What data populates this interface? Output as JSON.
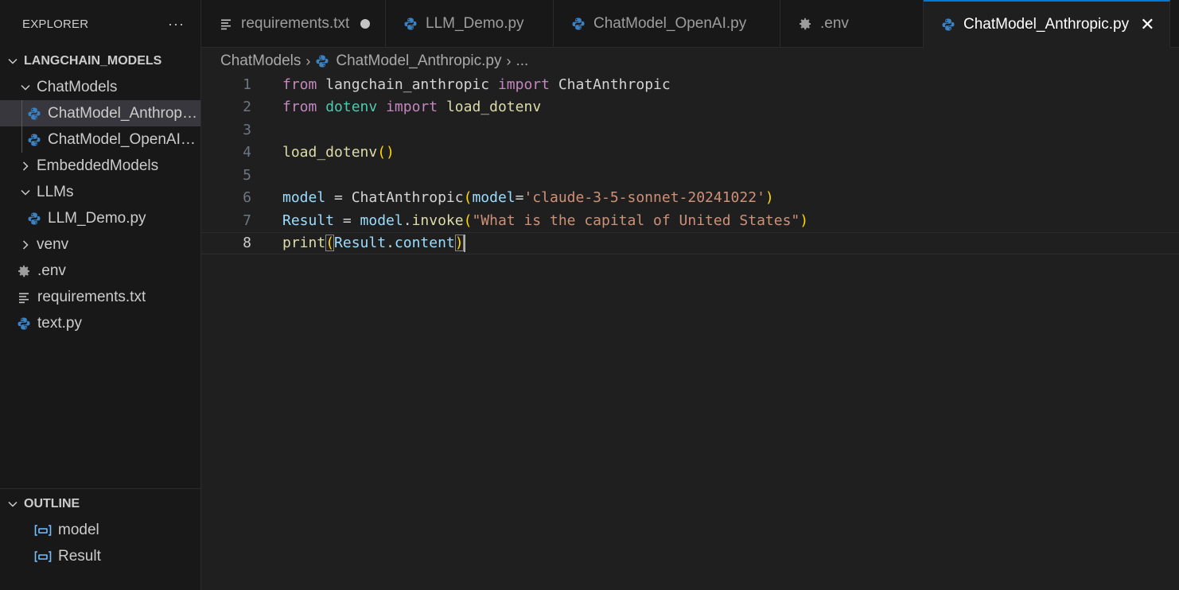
{
  "explorer": {
    "title": "EXPLORER",
    "more": "···",
    "root": "LANGCHAIN_MODELS",
    "items": [
      {
        "label": "ChatModels"
      },
      {
        "label": "ChatModel_Anthropic.py"
      },
      {
        "label": "ChatModel_OpenAI.py"
      },
      {
        "label": "EmbeddedModels"
      },
      {
        "label": "LLMs"
      },
      {
        "label": "LLM_Demo.py"
      },
      {
        "label": "venv"
      },
      {
        "label": ".env"
      },
      {
        "label": "requirements.txt"
      },
      {
        "label": "text.py"
      }
    ]
  },
  "outline": {
    "title": "OUTLINE",
    "items": [
      {
        "label": "model"
      },
      {
        "label": "Result"
      }
    ]
  },
  "tabs": [
    {
      "label": "requirements.txt"
    },
    {
      "label": "LLM_Demo.py"
    },
    {
      "label": "ChatModel_OpenAI.py"
    },
    {
      "label": ".env"
    },
    {
      "label": "ChatModel_Anthropic.py",
      "close": "✕"
    }
  ],
  "breadcrumb": {
    "folder": "ChatModels",
    "file": "ChatModel_Anthropic.py",
    "more": "..."
  },
  "editor": {
    "line_numbers": [
      "1",
      "2",
      "3",
      "4",
      "5",
      "6",
      "7",
      "8"
    ],
    "tokens": {
      "from": "from",
      "import": "import",
      "langchain_anthropic": "langchain_anthropic",
      "ChatAnthropic": "ChatAnthropic",
      "dotenv": "dotenv",
      "load_dotenv": "load_dotenv",
      "parens": "()",
      "model": "model",
      "eq": " = ",
      "open": "(",
      "close": ")",
      "model_kw": "model",
      "kw_eq": "=",
      "model_str": "'claude-3-5-sonnet-20241022'",
      "Result": "Result",
      "dot": ".",
      "invoke": "invoke",
      "question": "\"What is the capital of United States\"",
      "print": "print",
      "content": "content"
    }
  },
  "colors": {
    "accent": "#0078d4",
    "keyword": "#c586c0",
    "module": "#4ec9b0",
    "function": "#dcdcaa",
    "variable": "#9cdcfe",
    "string": "#ce9178",
    "python_blue": "#3b82c4",
    "python_yellow": "#f2c94c"
  }
}
